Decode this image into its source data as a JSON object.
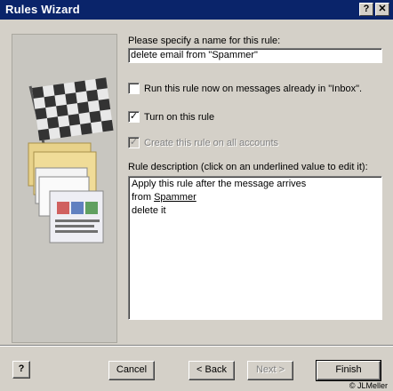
{
  "window": {
    "title": "Rules Wizard"
  },
  "titlebar": {
    "help_glyph": "?",
    "close_glyph": "✕"
  },
  "form": {
    "name_label": "Please specify a name for this rule:",
    "name_value": "delete email from \"Spammer\"",
    "run_now_label": "Run this rule now on messages already in \"Inbox\".",
    "run_now_checked": false,
    "turn_on_label": "Turn on this rule",
    "turn_on_checked": true,
    "all_accounts_label": "Create this rule on all accounts",
    "all_accounts_checked": false,
    "description_label": "Rule description (click on an underlined value to edit it):",
    "description_lines": [
      "Apply this rule after the message arrives",
      "from",
      "Spammer",
      "delete it"
    ]
  },
  "buttons": {
    "help": "?",
    "cancel": "Cancel",
    "back": "< Back",
    "next": "Next >",
    "finish": "Finish"
  },
  "credit": "© JLMeller"
}
